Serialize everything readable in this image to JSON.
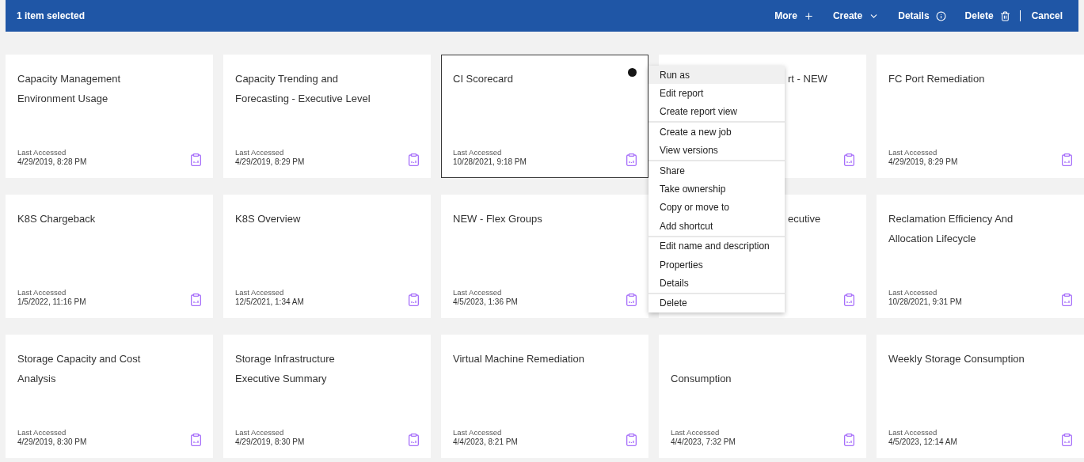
{
  "toolbar": {
    "title": "1 item selected",
    "actions": [
      {
        "label": "More"
      },
      {
        "label": "Create"
      },
      {
        "label": "Details"
      },
      {
        "label": "Delete"
      }
    ],
    "cancel": "Cancel"
  },
  "cards": [
    {
      "title": [
        "Capacity Management",
        "Environment Usage"
      ],
      "label": "Last Accessed",
      "date": "4/29/2019, 8:28 PM",
      "selected": false
    },
    {
      "title": [
        "Capacity Trending and",
        "Forecasting - Executive Level"
      ],
      "label": "Last Accessed",
      "date": "4/29/2019, 8:29 PM",
      "selected": false
    },
    {
      "title": [
        "CI Scorecard"
      ],
      "label": "Last Accessed",
      "date": "10/28/2021, 9:18 PM",
      "selected": true
    },
    {
      "title": [
        "rt - NEW"
      ],
      "kind": "clipped_left",
      "selected": false
    },
    {
      "title": [
        "FC Port Remediation"
      ],
      "label": "Last Accessed",
      "date": "4/29/2019, 8:29 PM",
      "selected": false
    },
    {
      "title": [
        "K8S Chargeback"
      ],
      "label": "Last Accessed",
      "date": "1/5/2022, 11:16 PM",
      "selected": false
    },
    {
      "title": [
        "K8S Overview"
      ],
      "label": "Last Accessed",
      "date": "12/5/2021, 1:34 AM",
      "selected": false
    },
    {
      "title": [
        "NEW - Flex Groups"
      ],
      "label": "Last Accessed",
      "date": "4/5/2023, 1:36 PM",
      "selected": false
    },
    {
      "title": [
        "ecutive"
      ],
      "kind": "clipped_left",
      "selected": false
    },
    {
      "title": [
        "Reclamation Efficiency And",
        "Allocation Lifecycle"
      ],
      "label": "Last Accessed",
      "date": "10/28/2021, 9:31 PM",
      "selected": false
    },
    {
      "title": [
        "Storage Capacity and Cost",
        "Analysis"
      ],
      "label": "Last Accessed",
      "date": "4/29/2019, 8:30 PM",
      "selected": false
    },
    {
      "title": [
        "Storage Infrastructure",
        "Executive Summary"
      ],
      "label": "Last Accessed",
      "date": "4/29/2019, 8:30 PM",
      "selected": false
    },
    {
      "title": [
        "Virtual Machine Remediation"
      ],
      "label": "Last Accessed",
      "date": "4/4/2023, 8:21 PM",
      "selected": false
    },
    {
      "title": [
        "Consumption"
      ],
      "kind": "clipped_top",
      "label": "Last Accessed",
      "date": "4/4/2023, 7:32 PM",
      "selected": false
    },
    {
      "title": [
        "Weekly Storage Consumption"
      ],
      "label": "Last Accessed",
      "date": "4/5/2023, 12:14 AM",
      "selected": false
    }
  ],
  "menu": {
    "groups": [
      [
        {
          "label": "Run as",
          "highlighted": true
        },
        {
          "label": "Edit report",
          "highlighted": false
        },
        {
          "label": "Create report view",
          "highlighted": false
        }
      ],
      [
        {
          "label": "Create a new job",
          "highlighted": false
        },
        {
          "label": "View versions",
          "highlighted": false
        }
      ],
      [
        {
          "label": "Share",
          "highlighted": false
        },
        {
          "label": "Take ownership",
          "highlighted": false
        },
        {
          "label": "Copy or move to",
          "highlighted": false
        },
        {
          "label": "Add shortcut",
          "highlighted": false
        }
      ],
      [
        {
          "label": "Edit name and description",
          "highlighted": false
        },
        {
          "label": "Properties",
          "highlighted": false
        },
        {
          "label": "Details",
          "highlighted": false
        }
      ],
      [
        {
          "label": "Delete",
          "highlighted": false
        }
      ]
    ]
  }
}
